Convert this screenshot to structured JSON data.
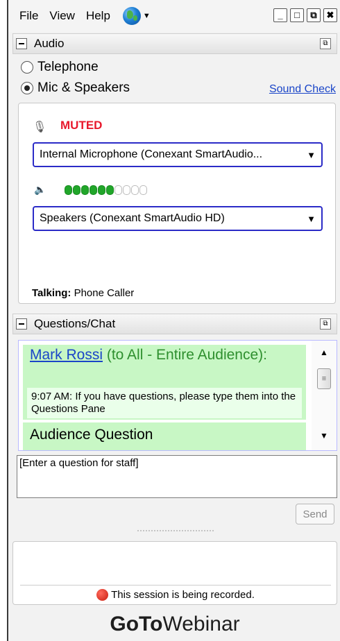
{
  "menu": {
    "items": [
      "File",
      "View",
      "Help"
    ]
  },
  "window_controls": {
    "minimize": "_",
    "maximize": "□",
    "restore": "⧉",
    "close": "✖"
  },
  "audio": {
    "title": "Audio",
    "telephone_label": "Telephone",
    "mic_label": "Mic & Speakers",
    "selected": "mic",
    "sound_check": "Sound Check",
    "muted_text": "MUTED",
    "microphone_device": "Internal Microphone (Conexant SmartAudio...",
    "speaker_level": 6,
    "speaker_level_max": 10,
    "speaker_device": "Speakers (Conexant SmartAudio HD)",
    "talking_label": "Talking:",
    "talking_value": "Phone Caller"
  },
  "chat": {
    "title": "Questions/Chat",
    "messages": [
      {
        "sender": "Mark Rossi",
        "audience": "(to All - Entire Audience):",
        "text": "9:07 AM: If you have questions, please type them into the Questions Pane"
      },
      {
        "sender": "Audience Question"
      }
    ],
    "input_value": "[Enter a question for staff]",
    "send_label": "Send"
  },
  "status": {
    "recording_text": "This session is being recorded."
  },
  "brand": {
    "part1": "GoTo",
    "part2": "Webinar"
  },
  "colors": {
    "accent_link": "#1a45c8",
    "muted": "#e8192c",
    "chat_bg": "#c8f7c5",
    "level_on": "#21a62a",
    "recording": "#c81c0e"
  }
}
